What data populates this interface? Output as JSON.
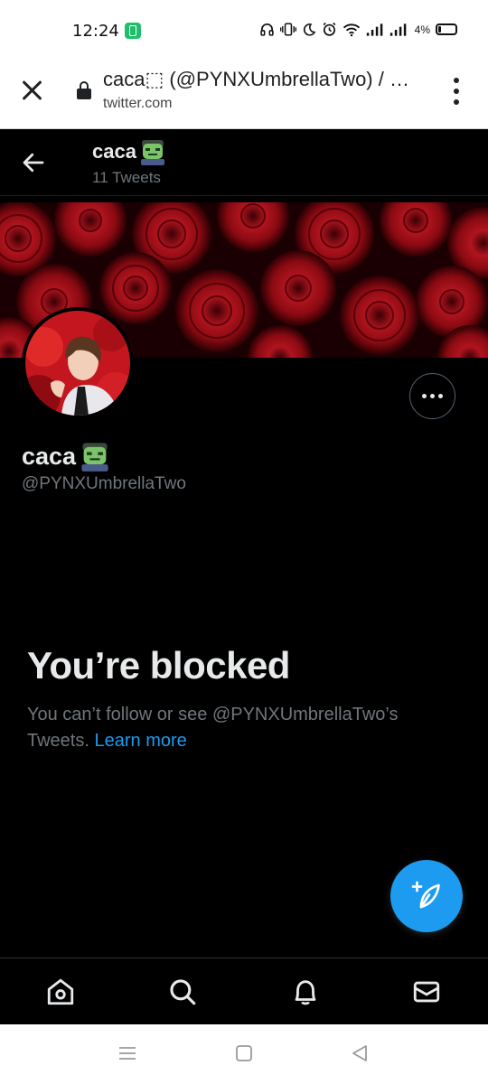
{
  "status_bar": {
    "time": "12:24",
    "battery_text": "4%",
    "icons": [
      "headphones-icon",
      "vibrate-icon",
      "moon-icon",
      "alarm-icon",
      "wifi-icon",
      "signal-icon",
      "signal-icon",
      "battery-icon"
    ]
  },
  "browser": {
    "page_title": "caca⬚ (@PYNXUmbrellaTwo) / …",
    "url": "twitter.com"
  },
  "header": {
    "name": "caca",
    "tweet_count": "11 Tweets"
  },
  "profile": {
    "name": "caca",
    "handle": "@PYNXUmbrellaTwo"
  },
  "blocked": {
    "title": "You’re blocked",
    "message": "You can’t follow or see @PYNXUmbrellaTwo’s Tweets.",
    "link": "Learn more"
  },
  "nav": {
    "items": [
      "home-icon",
      "search-icon",
      "notifications-icon",
      "messages-icon"
    ]
  },
  "colors": {
    "accent": "#1d9bf0",
    "background": "#000000",
    "secondary_text": "#71767b"
  }
}
